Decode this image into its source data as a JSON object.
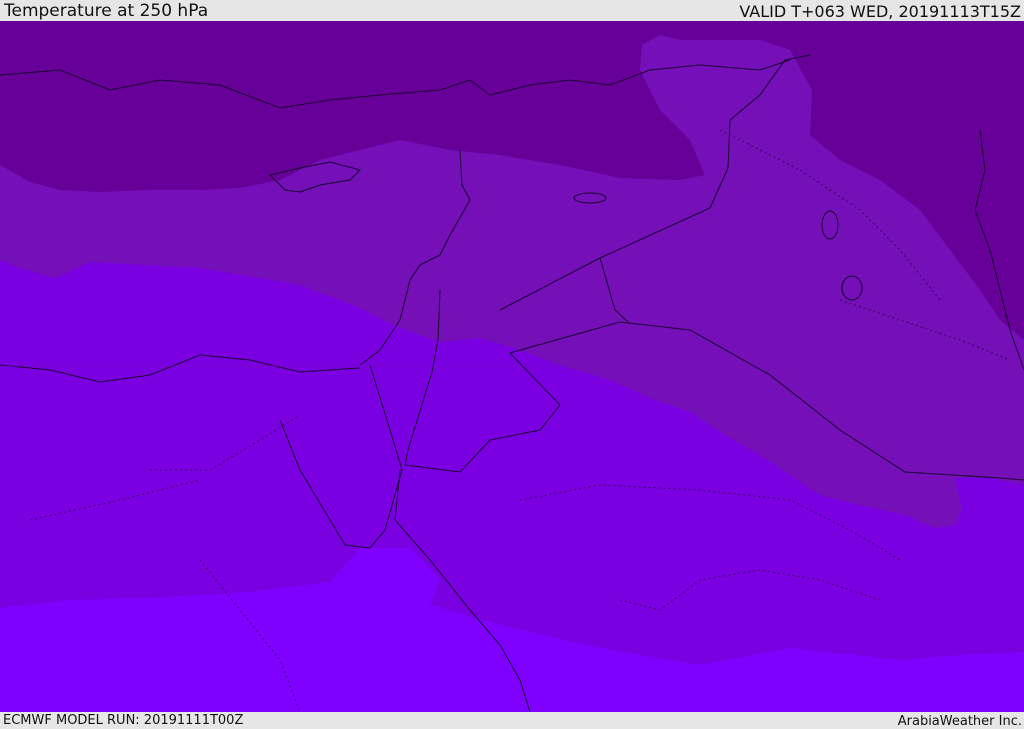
{
  "header": {
    "title": "Temperature at 250 hPa",
    "valid_time": "VALID T+063 WED, 20191113T15Z"
  },
  "footer": {
    "model_run": "ECMWF MODEL RUN: 20191111T00Z",
    "credit": "ArabiaWeather Inc."
  },
  "map": {
    "variable": "temperature",
    "pressure_level_hpa": 250,
    "colors": {
      "coldest_band": "#660099",
      "cold_band": "#7510b8",
      "mid_band": "#7b00e1",
      "warm_band": "#7f00ff",
      "borders": "#1a0033"
    }
  }
}
